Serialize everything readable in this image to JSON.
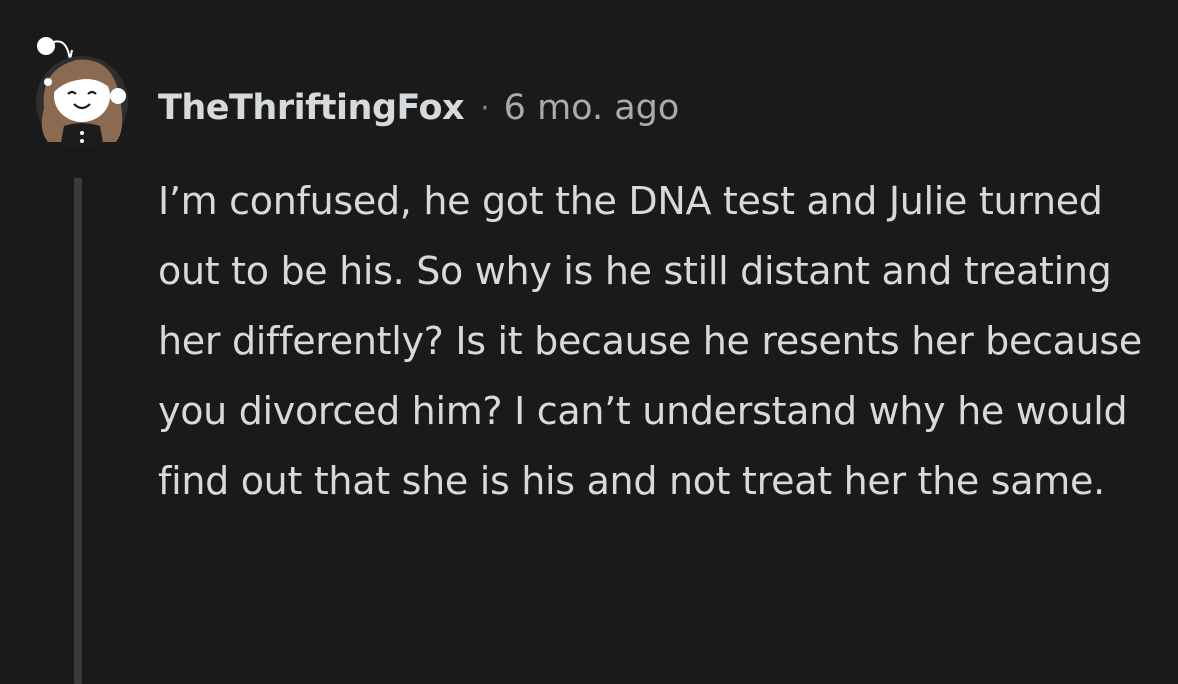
{
  "comment": {
    "username": "TheThriftingFox",
    "separator": "·",
    "timestamp": "6 mo. ago",
    "body": "I’m confused, he got the DNA test and Julie turned out to be his. So why is he still distant and treating her differently? Is it because he resents her because you divorced him? I can’t understand why he would find out that she is his and not treat her the same."
  },
  "icons": {
    "avatar": "snoo-avatar-icon"
  },
  "colors": {
    "background": "#1a1a1b",
    "username": "#d7dadc",
    "meta": "#a8aaab",
    "thread_line": "#3a3a3c"
  }
}
